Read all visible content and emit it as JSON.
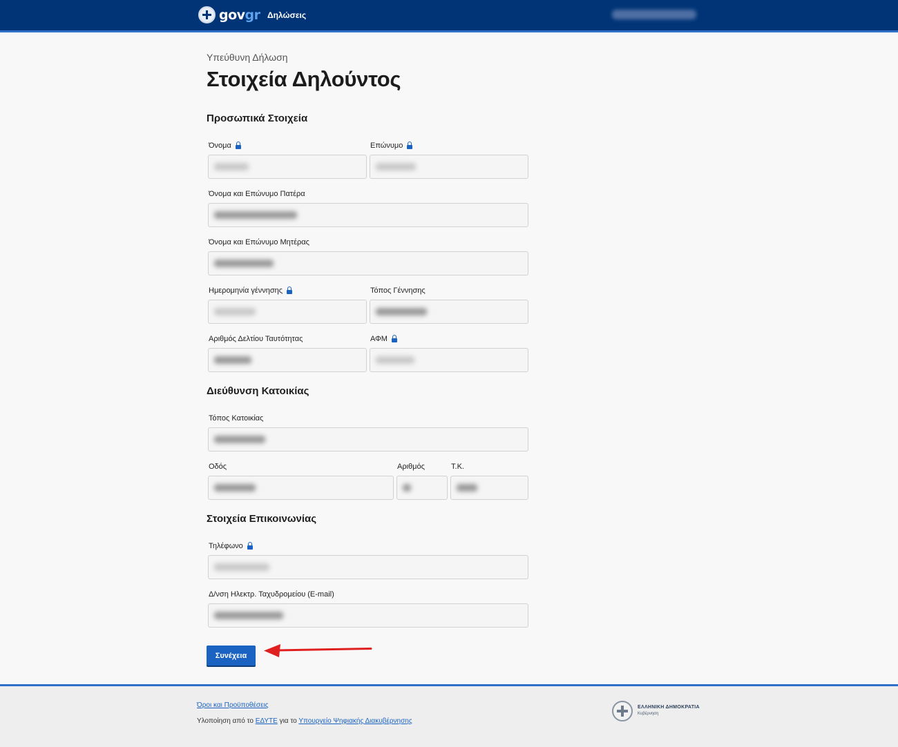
{
  "header": {
    "logo_text_gov": "gov",
    "logo_text_gr": "gr",
    "nav_declarations": "Δηλώσεις",
    "user_name": ""
  },
  "main": {
    "subtitle": "Υπεύθυνη Δήλωση",
    "title": "Στοιχεία Δηλούντος",
    "sections": {
      "personal": "Προσωπικά Στοιχεία",
      "address": "Διεύθυνση Κατοικίας",
      "contact": "Στοιχεία Επικοινωνίας"
    },
    "fields": {
      "first_name": {
        "label": "Όνομα",
        "locked": true,
        "value": ""
      },
      "last_name": {
        "label": "Επώνυμο",
        "locked": true,
        "value": ""
      },
      "father_name": {
        "label": "Όνομα και Επώνυμο Πατέρα",
        "locked": false,
        "value": ""
      },
      "mother_name": {
        "label": "Όνομα και Επώνυμο Μητέρας",
        "locked": false,
        "value": ""
      },
      "birth_date": {
        "label": "Ημερομηνία γέννησης",
        "locked": true,
        "value": ""
      },
      "birth_place": {
        "label": "Τόπος Γέννησης",
        "locked": false,
        "value": ""
      },
      "id_number": {
        "label": "Αριθμός Δελτίου Ταυτότητας",
        "locked": false,
        "value": ""
      },
      "afm": {
        "label": "ΑΦΜ",
        "locked": true,
        "value": ""
      },
      "residence_place": {
        "label": "Τόπος Κατοικίας",
        "locked": false,
        "value": ""
      },
      "street": {
        "label": "Οδός",
        "locked": false,
        "value": ""
      },
      "street_number": {
        "label": "Αριθμός",
        "locked": false,
        "value": ""
      },
      "postal_code": {
        "label": "Τ.Κ.",
        "locked": false,
        "value": ""
      },
      "phone": {
        "label": "Τηλέφωνο",
        "locked": true,
        "value": ""
      },
      "email": {
        "label": "Δ/νση Ηλεκτρ. Ταχυδρομείου (E-mail)",
        "locked": false,
        "value": ""
      }
    },
    "continue_label": "Συνέχεια"
  },
  "footer": {
    "terms_link": "Όροι και Προϋποθέσεις",
    "impl_prefix": "Υλοποίηση από το ",
    "edyte_link": "ΕΔΥΤΕ",
    "impl_middle": " για το ",
    "ministry_link": "Υπουργείο Ψηφιακής Διακυβέρνησης",
    "gov_name": "ΕΛΛΗΝΙΚΗ ΔΗΜΟΚΡΑΤΙΑ",
    "gov_sub": "Κυβέρνηση"
  },
  "colors": {
    "header_bg": "#003476",
    "accent": "#1a63c2",
    "annotation_arrow": "#e02020"
  }
}
